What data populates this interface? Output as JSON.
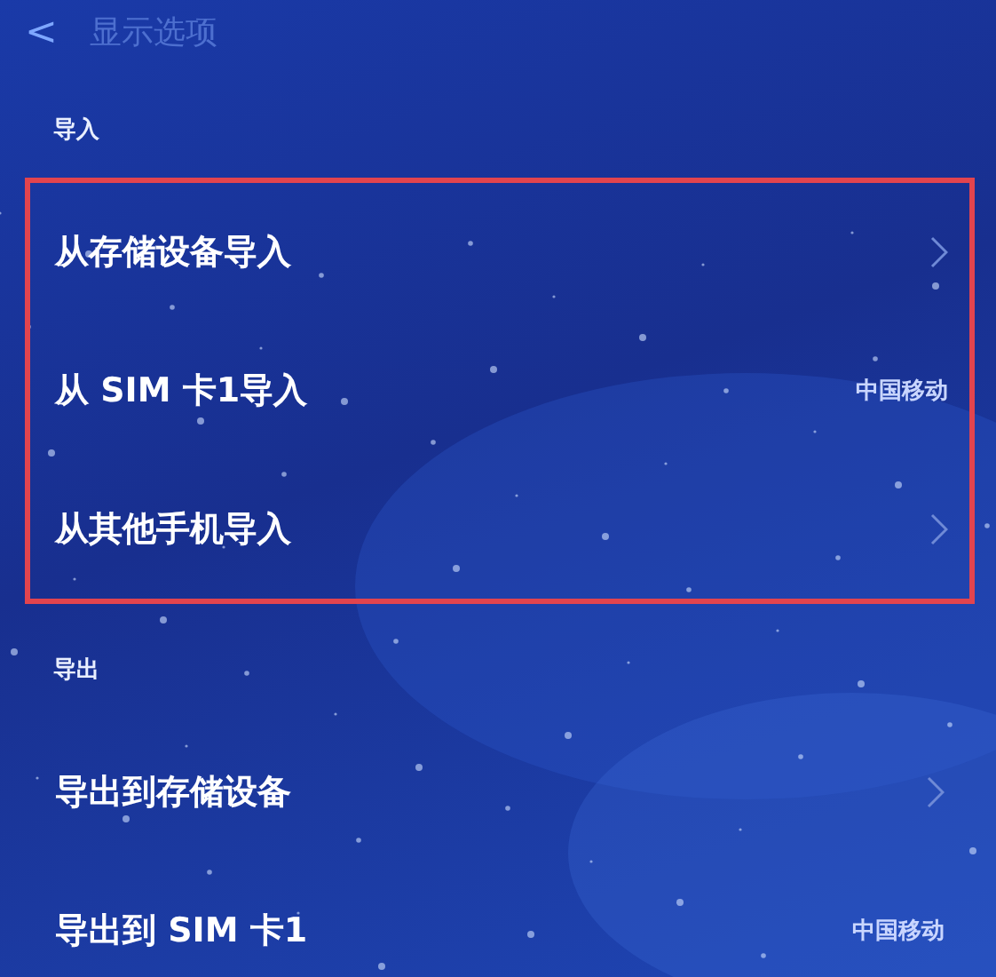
{
  "header": {
    "back": "<",
    "title": "显示选项"
  },
  "sections": [
    {
      "label": "导入",
      "highlighted": true,
      "items": [
        {
          "label": "从存储设备导入",
          "kind": "chevron"
        },
        {
          "label": "从 SIM 卡1导入",
          "kind": "value",
          "value": "中国移动"
        },
        {
          "label": "从其他手机导入",
          "kind": "chevron"
        }
      ]
    },
    {
      "label": "导出",
      "highlighted": false,
      "items": [
        {
          "label": "导出到存储设备",
          "kind": "chevron"
        },
        {
          "label": "导出到 SIM 卡1",
          "kind": "value",
          "value": "中国移动"
        }
      ]
    }
  ]
}
